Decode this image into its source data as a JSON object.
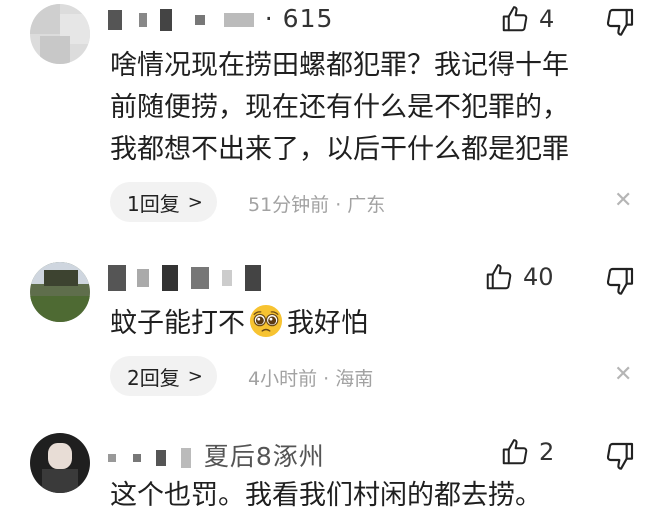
{
  "comments": [
    {
      "username": "· 615",
      "likes": "4",
      "lines": [
        "啥情况现在捞田螺都犯罪？我记得十年",
        "前随便捞，现在还有什么是不犯罪的，",
        "我都想不出来了，以后干什么都是犯罪"
      ],
      "reply_label": "1回复",
      "meta": "51分钟前 · 广东"
    },
    {
      "username": "",
      "likes": "40",
      "text_before": "蚊子能打不",
      "text_after": "我好怕",
      "reply_label": "2回复",
      "meta": "4小时前 · 海南"
    },
    {
      "username": "夏后8涿州",
      "likes": "2",
      "lines": [
        "这个也罚。我看我们村闲的都去捞。"
      ]
    }
  ],
  "icons": {
    "like": "thumbs-up-icon",
    "dislike": "thumbs-down-icon",
    "close": "close-icon",
    "chevron": "chevron-right-icon",
    "emoji": "pleading-face-emoji"
  },
  "colors": {
    "meta": "#a2a2a2",
    "pill_bg": "#f2f2f2",
    "emoji": "#f7c331"
  }
}
